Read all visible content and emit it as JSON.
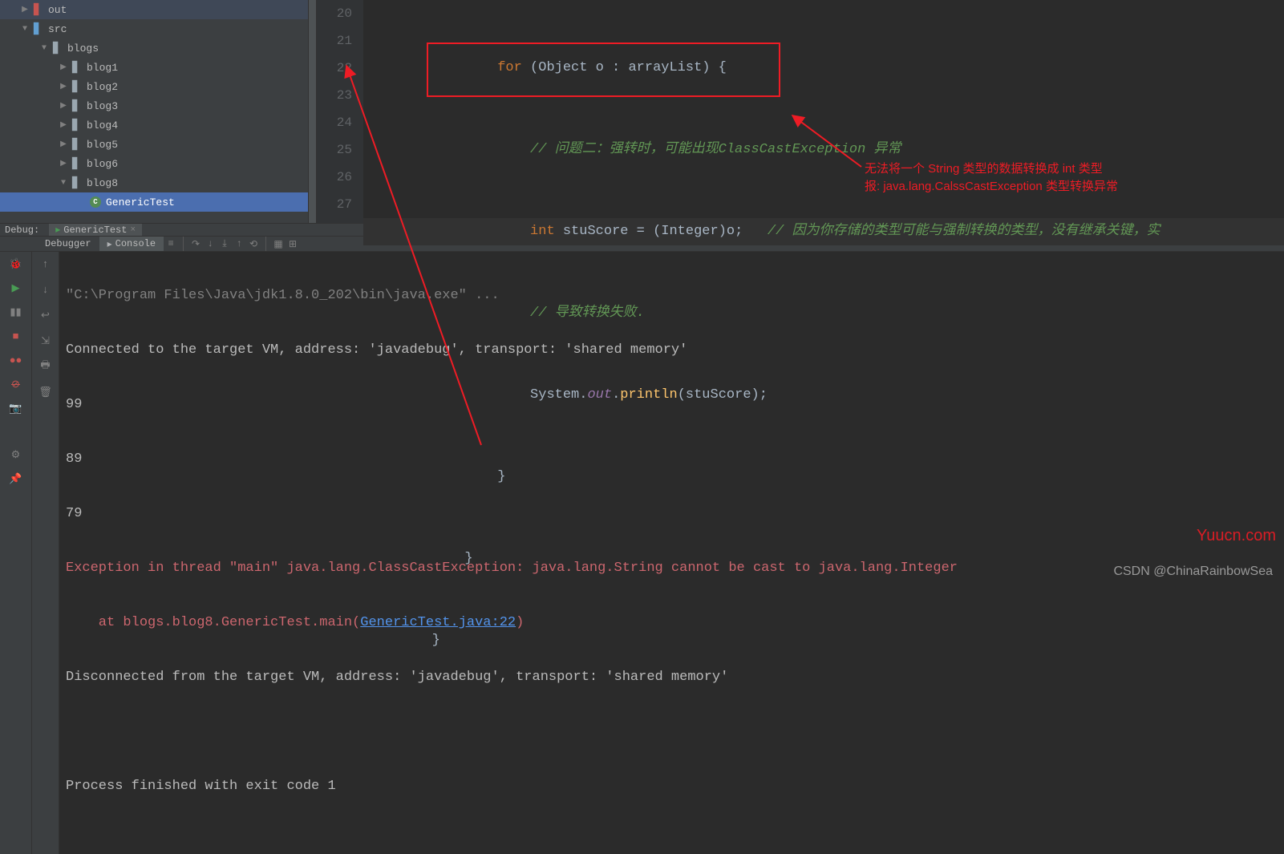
{
  "tree": {
    "items": [
      {
        "label": "out",
        "level": 1,
        "arrow": "▶",
        "icon": "folder-exc"
      },
      {
        "label": "src",
        "level": 1,
        "arrow": "▼",
        "icon": "folder-open"
      },
      {
        "label": "blogs",
        "level": 2,
        "arrow": "▼",
        "icon": "folder"
      },
      {
        "label": "blog1",
        "level": 3,
        "arrow": "▶",
        "icon": "folder"
      },
      {
        "label": "blog2",
        "level": 3,
        "arrow": "▶",
        "icon": "folder"
      },
      {
        "label": "blog3",
        "level": 3,
        "arrow": "▶",
        "icon": "folder"
      },
      {
        "label": "blog4",
        "level": 3,
        "arrow": "▶",
        "icon": "folder"
      },
      {
        "label": "blog5",
        "level": 3,
        "arrow": "▶",
        "icon": "folder"
      },
      {
        "label": "blog6",
        "level": 3,
        "arrow": "▶",
        "icon": "folder"
      },
      {
        "label": "blog8",
        "level": 3,
        "arrow": "▼",
        "icon": "folder"
      },
      {
        "label": "GenericTest",
        "level": 4,
        "arrow": "",
        "icon": "class",
        "selected": true
      }
    ]
  },
  "gutter": [
    "20",
    "21",
    "22",
    "23",
    "24",
    "25",
    "26",
    "27"
  ],
  "code": {
    "line20": {
      "indent": "                ",
      "kw": "for",
      "rest": " (Object o : arrayList) {"
    },
    "line21": {
      "indent": "                    ",
      "comment": "// 问题二：强转时，可能出现ClassCastException 异常"
    },
    "line22": {
      "indent": "                    ",
      "kw": "int",
      "var": " stuScore = (Integer)o;",
      "tail": "   // 因为你存储的类型可能与强制转换的类型，没有继承关键，实"
    },
    "line23": {
      "indent": "                    ",
      "comment": "// 导致转换失败."
    },
    "line24": {
      "indent": "                    ",
      "cls": "System",
      "dot1": ".",
      "fld": "out",
      "dot2": ".",
      "mth": "println",
      "args": "(stuScore);"
    },
    "line25": {
      "indent": "                ",
      "brace": "}"
    },
    "line26": {
      "indent": "            ",
      "brace": "}"
    },
    "line27": {
      "indent": "        ",
      "brace": "}"
    }
  },
  "annotation": {
    "l1": "无法将一个 String 类型的数据转换成 int 类型",
    "l2": "报: java.lang.CalssCastException 类型转换异常"
  },
  "debug": {
    "title": "Debug:",
    "tab": "GenericTest",
    "subtabs": {
      "debugger": "Debugger",
      "console": "Console"
    }
  },
  "console": {
    "l1": "\"C:\\Program Files\\Java\\jdk1.8.0_202\\bin\\java.exe\" ...",
    "l2": "Connected to the target VM, address: 'javadebug', transport: 'shared memory'",
    "l3": "99",
    "l4": "89",
    "l5": "79",
    "l6": "Exception in thread \"main\" java.lang.ClassCastException: java.lang.String cannot be cast to java.lang.Integer",
    "l7a": "    at blogs.blog8.GenericTest.main(",
    "l7b": "GenericTest.java:22",
    "l7c": ")",
    "l8": "Disconnected from the target VM, address: 'javadebug', transport: 'shared memory'",
    "l9": "",
    "l10": "Process finished with exit code 1"
  },
  "watermark": "Yuucn.com",
  "csdn": "CSDN @ChinaRainbowSea"
}
